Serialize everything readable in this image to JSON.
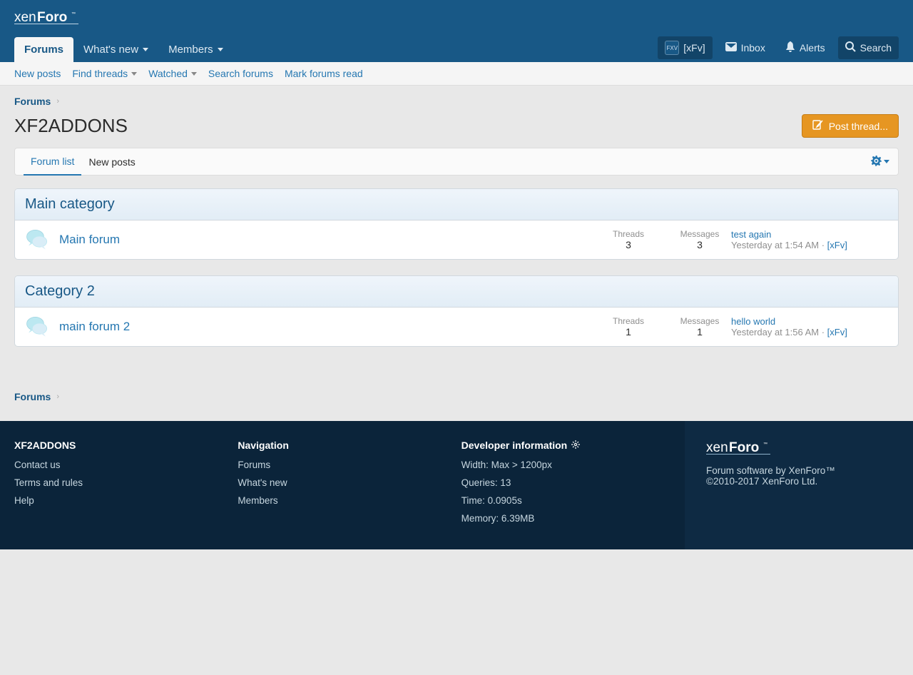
{
  "brand": "xenForo",
  "nav": {
    "tabs": [
      "Forums",
      "What's new",
      "Members"
    ],
    "right": {
      "user": "[xFv]",
      "inbox": "Inbox",
      "alerts": "Alerts",
      "search": "Search"
    }
  },
  "subnav": [
    "New posts",
    "Find threads",
    "Watched",
    "Search forums",
    "Mark forums read"
  ],
  "breadcrumb": "Forums",
  "page_title": "XF2ADDONS",
  "post_thread_label": "Post thread...",
  "viewtabs": {
    "forum_list": "Forum list",
    "new_posts": "New posts"
  },
  "labels": {
    "threads": "Threads",
    "messages": "Messages"
  },
  "categories": [
    {
      "title": "Main category",
      "nodes": [
        {
          "title": "Main forum",
          "threads": "3",
          "messages": "3",
          "latest_title": "test again",
          "latest_time": "Yesterday at 1:54 AM",
          "latest_user": "[xFv]"
        }
      ]
    },
    {
      "title": "Category 2",
      "nodes": [
        {
          "title": "main forum 2",
          "threads": "1",
          "messages": "1",
          "latest_title": "hello world",
          "latest_time": "Yesterday at 1:56 AM",
          "latest_user": "[xFv]"
        }
      ]
    }
  ],
  "footer": {
    "col1_title": "XF2ADDONS",
    "col1_links": [
      "Contact us",
      "Terms and rules",
      "Help"
    ],
    "col2_title": "Navigation",
    "col2_links": [
      "Forums",
      "What's new",
      "Members"
    ],
    "dev_title": "Developer information",
    "dev_info": [
      "Width: Max > 1200px",
      "Queries: 13",
      "Time: 0.0905s",
      "Memory: 6.39MB"
    ],
    "software": "Forum software by XenForo™",
    "copyright": "©2010-2017 XenForo Ltd."
  }
}
